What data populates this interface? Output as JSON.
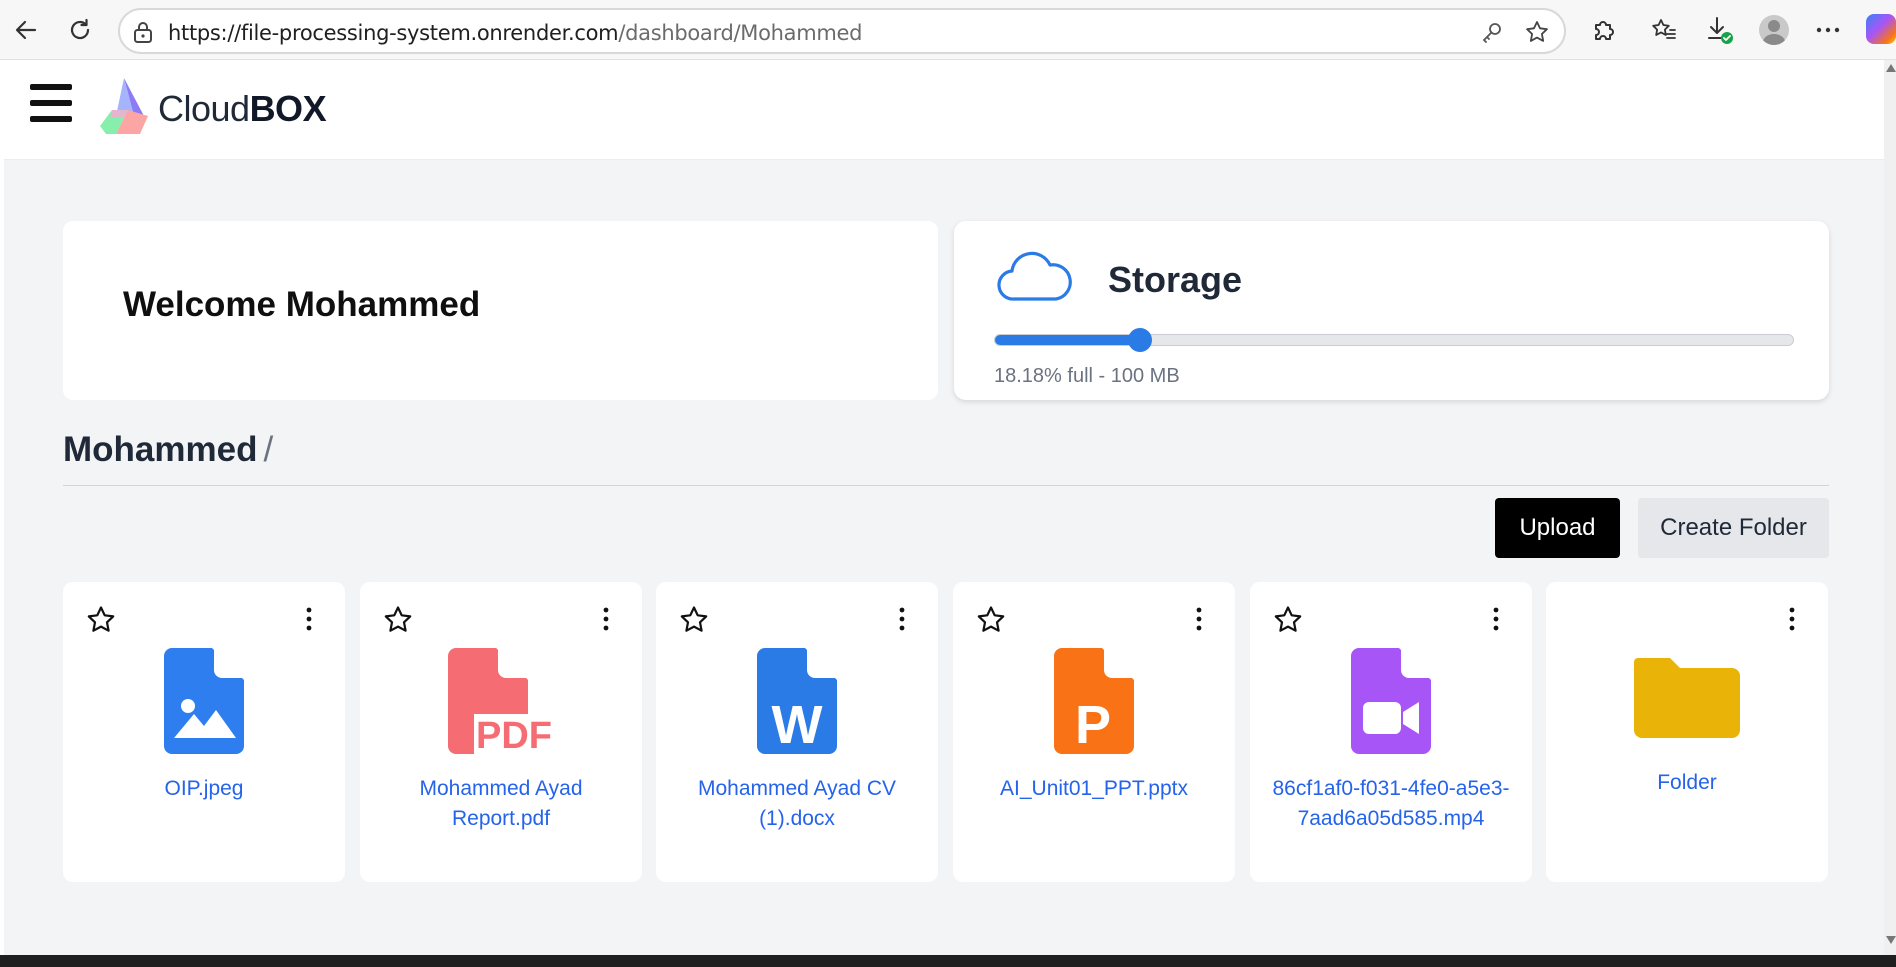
{
  "browser": {
    "url_host": "https://file-processing-system.onrender.com",
    "url_path": "/dashboard/Mohammed"
  },
  "app": {
    "logo_text_light": "Cloud",
    "logo_text_bold": "BOX"
  },
  "welcome": {
    "title": "Welcome Mohammed"
  },
  "storage": {
    "title": "Storage",
    "percent_full": 18.18,
    "info": "18.18% full - 100 MB",
    "accent_color": "#2b7be6"
  },
  "breadcrumb": {
    "current": "Mohammed",
    "separator": "/"
  },
  "actions": {
    "upload_label": "Upload",
    "create_folder_label": "Create Folder"
  },
  "files": [
    {
      "name": "OIP.jpeg",
      "type": "image",
      "icon": "image-file-icon",
      "color": "#2f7ef0"
    },
    {
      "name": "Mohammed Ayad Report.pdf",
      "type": "pdf",
      "icon": "pdf-file-icon",
      "color": "#f56d72"
    },
    {
      "name": "Mohammed Ayad CV (1).docx",
      "type": "word",
      "icon": "word-file-icon",
      "color": "#2b7be6"
    },
    {
      "name": "AI_Unit01_PPT.pptx",
      "type": "powerpoint",
      "icon": "powerpoint-file-icon",
      "color": "#f97316"
    },
    {
      "name": "86cf1af0-f031-4fe0-a5e3-7aad6a05d585.mp4",
      "type": "video",
      "icon": "video-file-icon",
      "color": "#a855f7"
    },
    {
      "name": "Folder",
      "type": "folder",
      "icon": "folder-icon",
      "color": "#eab308"
    }
  ]
}
